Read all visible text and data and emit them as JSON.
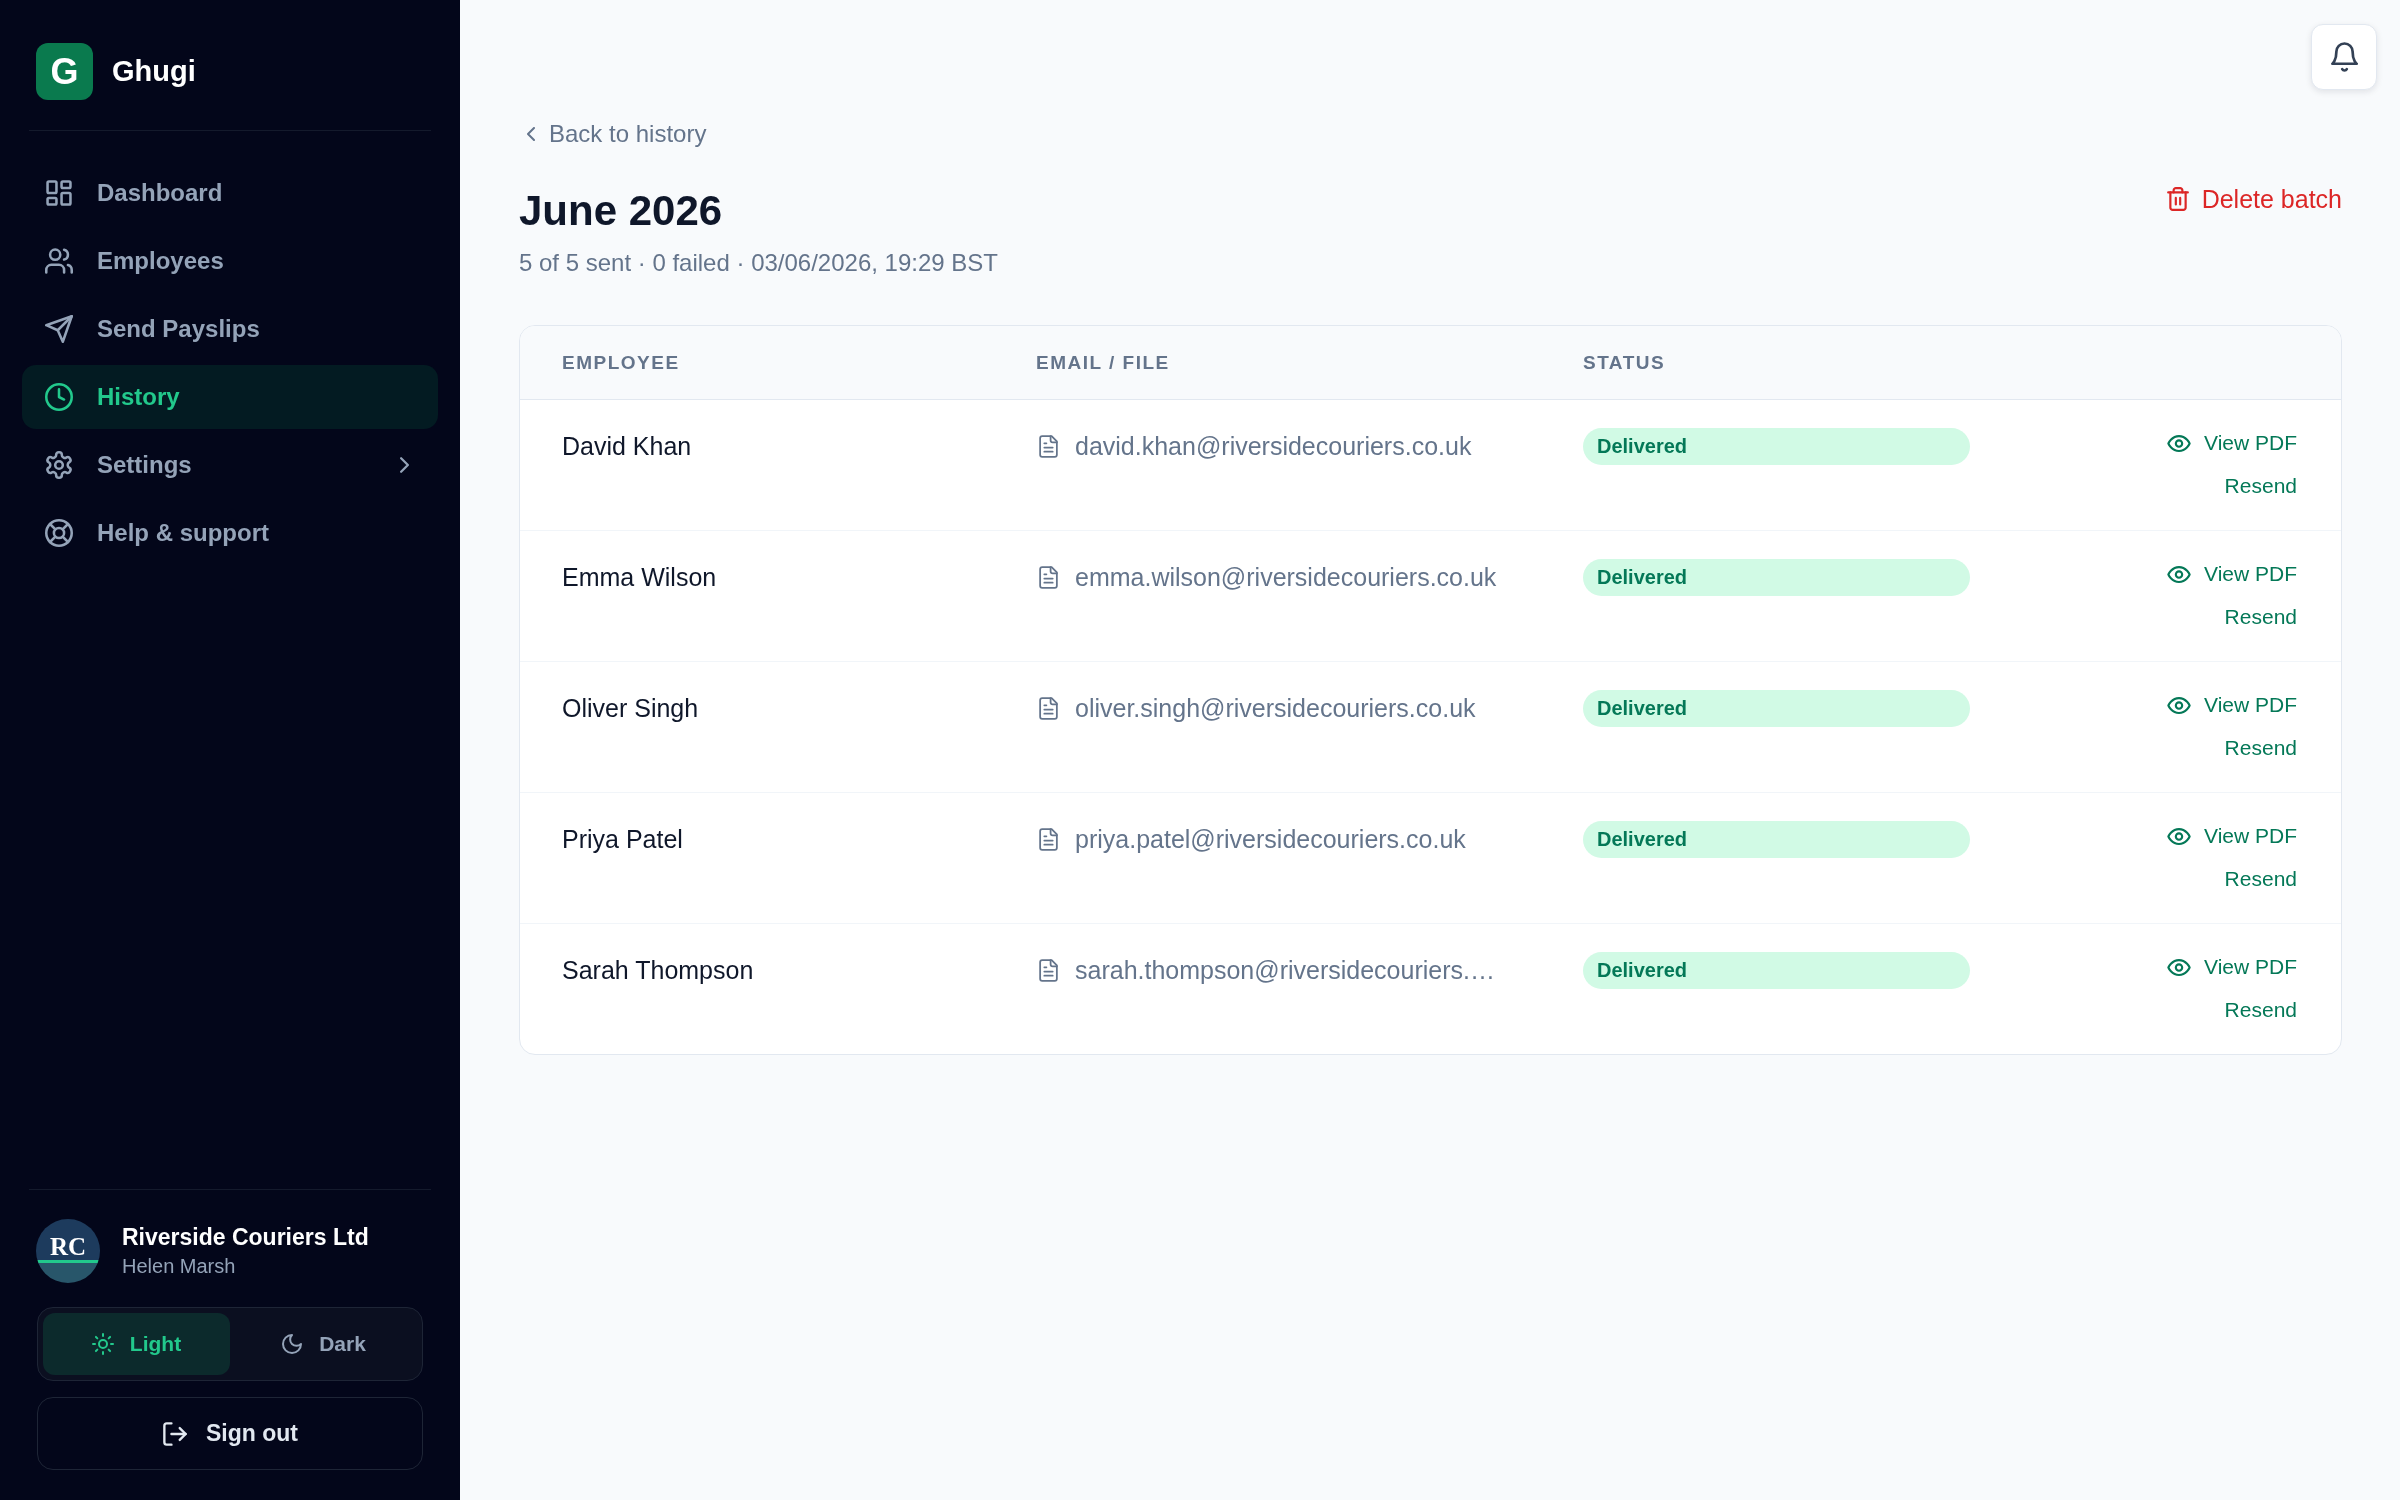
{
  "sidebar": {
    "brand": {
      "logo_letter": "G",
      "name": "Ghugi"
    },
    "nav": [
      {
        "label": "Dashboard",
        "kind": "link",
        "selected": false
      },
      {
        "label": "Employees",
        "kind": "link",
        "selected": false
      },
      {
        "label": "Send Payslips",
        "kind": "link",
        "selected": false
      },
      {
        "label": "History",
        "kind": "link",
        "selected": true
      },
      {
        "label": "Settings",
        "kind": "group",
        "selected": false
      },
      {
        "label": "Help & support",
        "kind": "link",
        "selected": false
      }
    ],
    "account": {
      "logo_initials": "RC",
      "company": "Riverside Couriers Ltd",
      "user": "Helen Marsh"
    },
    "theme": [
      {
        "label": "Light",
        "selected": true
      },
      {
        "label": "Dark",
        "selected": false
      }
    ],
    "sign_out": "Sign out"
  },
  "back_link": "Back to history",
  "title": "June 2026",
  "summary": "5 of 5 sent · 0 failed · 03/06/2026, 19:29 BST",
  "delete_button": "Delete batch",
  "table": {
    "columns": [
      "EMPLOYEE",
      "EMAIL / FILE",
      "STATUS"
    ],
    "rows": [
      {
        "employee": "David Khan",
        "email": "david.khan@riversidecouriers.co.uk",
        "status": "Delivered",
        "view": "View PDF",
        "resend": "Resend"
      },
      {
        "employee": "Emma Wilson",
        "email": "emma.wilson@riversidecouriers.co.uk",
        "status": "Delivered",
        "view": "View PDF",
        "resend": "Resend"
      },
      {
        "employee": "Oliver Singh",
        "email": "oliver.singh@riversidecouriers.co.uk",
        "status": "Delivered",
        "view": "View PDF",
        "resend": "Resend"
      },
      {
        "employee": "Priya Patel",
        "email": "priya.patel@riversidecouriers.co.uk",
        "status": "Delivered",
        "view": "View PDF",
        "resend": "Resend"
      },
      {
        "employee": "Sarah Thompson",
        "email": "sarah.thompson@riversidecouriers.…",
        "status": "Delivered",
        "view": "View PDF",
        "resend": "Resend"
      }
    ]
  }
}
